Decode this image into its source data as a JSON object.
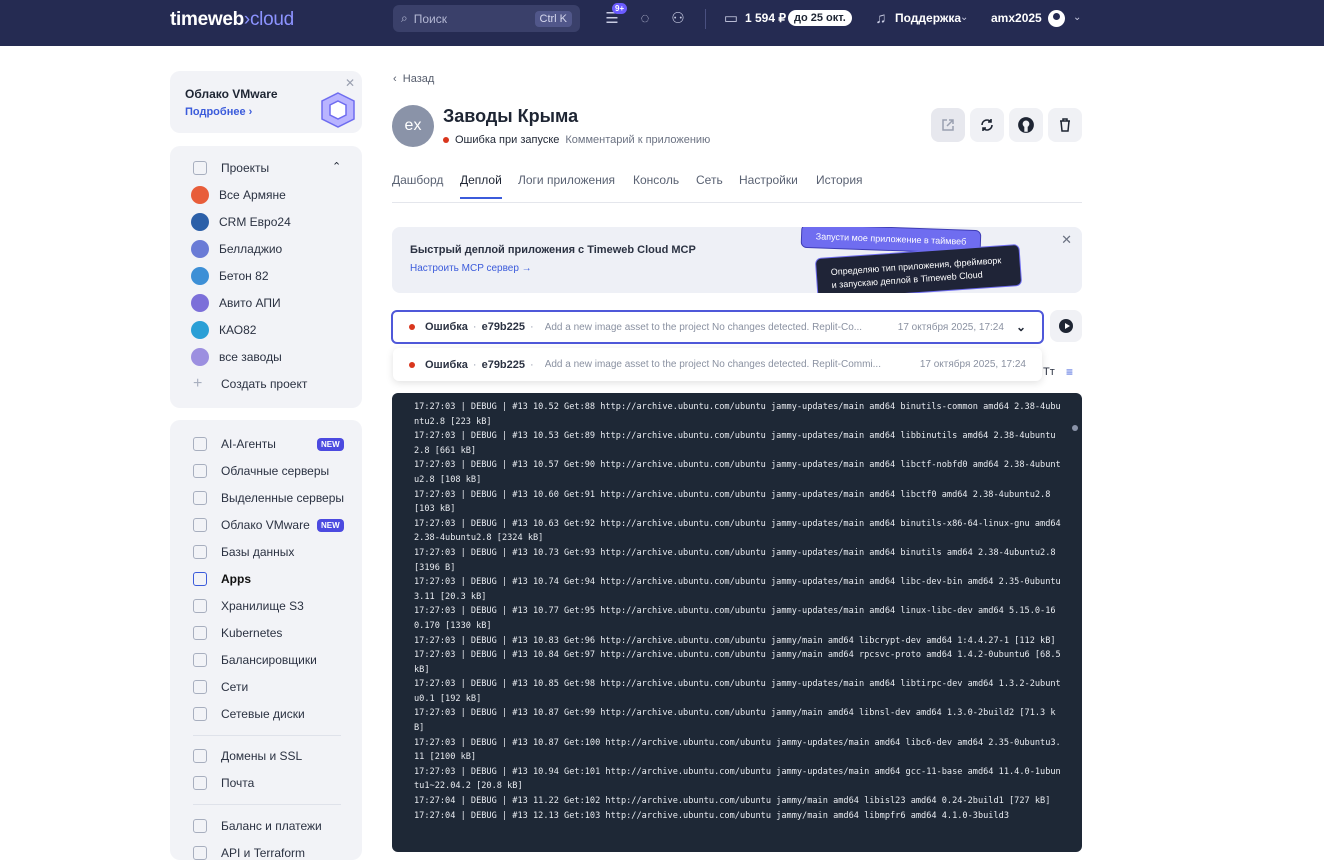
{
  "header": {
    "logo_part1": "timeweb",
    "logo_part2": "cloud",
    "search_placeholder": "Поиск",
    "search_shortcut": "Ctrl K",
    "notifications_badge": "9+",
    "balance": "1 594 ₽",
    "due": "до 25 окт.",
    "support": "Поддержка",
    "username": "amx2025"
  },
  "sidebar": {
    "promo": {
      "title": "Облако VMware",
      "link": "Подробнее"
    },
    "projects": {
      "title": "Проекты",
      "items": [
        {
          "label": "Все Армяне",
          "color": "#e85d3a"
        },
        {
          "label": "CRM Евро24",
          "color": "#2b5fa8"
        },
        {
          "label": "Белладжио",
          "color": "#6a7bd6"
        },
        {
          "label": "Бетон 82",
          "color": "#3d8fd6"
        },
        {
          "label": "Авито АПИ",
          "color": "#7c6fd9"
        },
        {
          "label": "КАО82",
          "color": "#2a9fd6"
        },
        {
          "label": "все заводы",
          "color": "#9c8fe0"
        }
      ],
      "create": "Создать проект"
    },
    "services": [
      {
        "label": "AI-Агенты",
        "badge": "NEW",
        "icon": "robot-icon"
      },
      {
        "label": "Облачные серверы",
        "icon": "cloud-icon"
      },
      {
        "label": "Выделенные серверы",
        "icon": "server-icon"
      },
      {
        "label": "Облако VMware",
        "badge": "NEW",
        "icon": "vmware-icon"
      },
      {
        "label": "Базы данных",
        "icon": "database-icon"
      },
      {
        "label": "Apps",
        "active": true,
        "icon": "apps-icon"
      },
      {
        "label": "Хранилище S3",
        "icon": "storage-icon"
      },
      {
        "label": "Kubernetes",
        "icon": "kubernetes-icon"
      },
      {
        "label": "Балансировщики",
        "icon": "balancer-icon"
      },
      {
        "label": "Сети",
        "icon": "network-icon"
      },
      {
        "label": "Сетевые диски",
        "icon": "disk-icon"
      }
    ],
    "services2": [
      {
        "label": "Домены и SSL",
        "icon": "globe-icon"
      },
      {
        "label": "Почта",
        "icon": "mail-icon"
      }
    ],
    "services3": [
      {
        "label": "Баланс и платежи",
        "icon": "wallet-icon"
      },
      {
        "label": "API и Terraform",
        "icon": "api-icon"
      }
    ]
  },
  "main": {
    "back": "Назад",
    "avatar_text": "ex",
    "title": "Заводы Крыма",
    "status": "Ошибка при запуске",
    "comment": "Комментарий к приложению",
    "tabs": [
      "Дашборд",
      "Деплой",
      "Логи приложения",
      "Консоль",
      "Сеть",
      "Настройки",
      "История"
    ],
    "active_tab": "Деплой",
    "mcp_banner": {
      "title": "Быстрый деплой приложения с Timeweb Cloud MCP",
      "link": "Настроить MCP сервер →",
      "bubble1": "Запусти мое приложение в таймвеб",
      "bubble2": "Определяю тип приложения, фреймворк и запускаю деплой в Timeweb Cloud"
    },
    "deploy_selected": {
      "status": "Ошибка",
      "hash": "e79b225",
      "message": "Add a new image asset to the project No changes detected. Replit-Co...",
      "date": "17 октября 2025, 17:24"
    },
    "deploy_option": {
      "status": "Ошибка",
      "hash": "e79b225",
      "message": "Add a new image asset to the project No changes detected. Replit-Commi...",
      "date": "17 октября 2025, 17:24"
    },
    "font_control": "Тт",
    "log_lines": [
      "17:27:03 | DEBUG | #13 10.52 Get:88 http://archive.ubuntu.com/ubuntu jammy-updates/main amd64 binutils-common amd64 2.38-4ubuntu2.8 [223 kB]",
      "17:27:03 | DEBUG | #13 10.53 Get:89 http://archive.ubuntu.com/ubuntu jammy-updates/main amd64 libbinutils amd64 2.38-4ubuntu2.8 [661 kB]",
      "17:27:03 | DEBUG | #13 10.57 Get:90 http://archive.ubuntu.com/ubuntu jammy-updates/main amd64 libctf-nobfd0 amd64 2.38-4ubuntu2.8 [108 kB]",
      "17:27:03 | DEBUG | #13 10.60 Get:91 http://archive.ubuntu.com/ubuntu jammy-updates/main amd64 libctf0 amd64 2.38-4ubuntu2.8 [103 kB]",
      "17:27:03 | DEBUG | #13 10.63 Get:92 http://archive.ubuntu.com/ubuntu jammy-updates/main amd64 binutils-x86-64-linux-gnu amd64 2.38-4ubuntu2.8 [2324 kB]",
      "17:27:03 | DEBUG | #13 10.73 Get:93 http://archive.ubuntu.com/ubuntu jammy-updates/main amd64 binutils amd64 2.38-4ubuntu2.8 [3196 B]",
      "17:27:03 | DEBUG | #13 10.74 Get:94 http://archive.ubuntu.com/ubuntu jammy-updates/main amd64 libc-dev-bin amd64 2.35-0ubuntu3.11 [20.3 kB]",
      "17:27:03 | DEBUG | #13 10.77 Get:95 http://archive.ubuntu.com/ubuntu jammy-updates/main amd64 linux-libc-dev amd64 5.15.0-160.170 [1330 kB]",
      "17:27:03 | DEBUG | #13 10.83 Get:96 http://archive.ubuntu.com/ubuntu jammy/main amd64 libcrypt-dev amd64 1:4.4.27-1 [112 kB]",
      "17:27:03 | DEBUG | #13 10.84 Get:97 http://archive.ubuntu.com/ubuntu jammy/main amd64 rpcsvc-proto amd64 1.4.2-0ubuntu6 [68.5 kB]",
      "17:27:03 | DEBUG | #13 10.85 Get:98 http://archive.ubuntu.com/ubuntu jammy-updates/main amd64 libtirpc-dev amd64 1.3.2-2ubuntu0.1 [192 kB]",
      "17:27:03 | DEBUG | #13 10.87 Get:99 http://archive.ubuntu.com/ubuntu jammy/main amd64 libnsl-dev amd64 1.3.0-2build2 [71.3 kB]",
      "17:27:03 | DEBUG | #13 10.87 Get:100 http://archive.ubuntu.com/ubuntu jammy-updates/main amd64 libc6-dev amd64 2.35-0ubuntu3.11 [2100 kB]",
      "17:27:03 | DEBUG | #13 10.94 Get:101 http://archive.ubuntu.com/ubuntu jammy-updates/main amd64 gcc-11-base amd64 11.4.0-1ubuntu1~22.04.2 [20.8 kB]",
      "17:27:04 | DEBUG | #13 11.22 Get:102 http://archive.ubuntu.com/ubuntu jammy/main amd64 libisl23 amd64 0.24-2build1 [727 kB]",
      "17:27:04 | DEBUG | #13 12.13 Get:103 http://archive.ubuntu.com/ubuntu jammy/main amd64 libmpfr6 amd64 4.1.0-3build3"
    ]
  }
}
